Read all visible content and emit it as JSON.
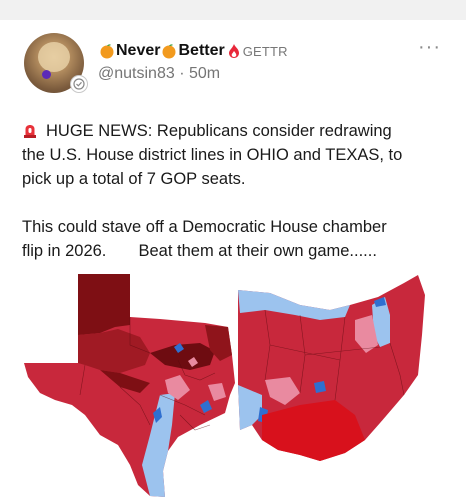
{
  "post": {
    "author": {
      "name_part1": "Never",
      "name_part2": "Better",
      "platform": "GETTR",
      "handle": "@nutsin83",
      "separator": "·",
      "time": "50m"
    },
    "text_line1": "HUGE NEWS: Republicans consider redrawing",
    "text_line2": "the U.S. House district lines in OHIO and TEXAS, to",
    "text_line3": "pick up a total of 7 GOP seats.",
    "text_line4": "This could stave off a Democratic House chamber",
    "text_line5": "flip in 2026.       Beat them at their own game......",
    "icons": {
      "avatar": "avatar-photo",
      "verified": "verified-badge-icon",
      "orange": "orange-icon",
      "flame": "flame-icon",
      "siren": "siren-icon",
      "more": "more-options-icon"
    }
  },
  "colors": {
    "dark_red": "#7e0f14",
    "red": "#c8283c",
    "bright_red": "#d8111c",
    "pink": "#e98aa0",
    "light_blue": "#9cc3ee",
    "blue": "#2f6fd0"
  }
}
